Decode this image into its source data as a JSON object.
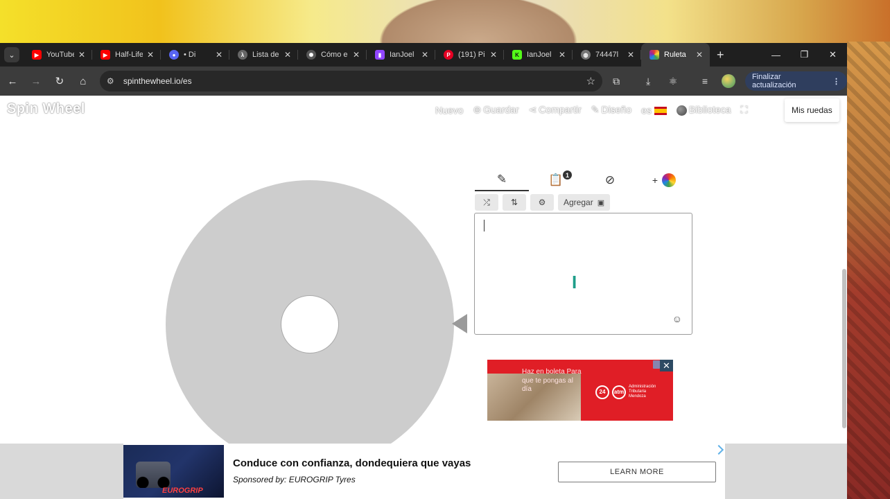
{
  "browser": {
    "tabs": [
      {
        "title": "YouTube",
        "favicon": "youtube-icon",
        "color": "#ff0000"
      },
      {
        "title": "Half-Life",
        "favicon": "youtube-icon",
        "color": "#ff0000"
      },
      {
        "title": "• Di",
        "favicon": "record-icon",
        "color": "#5865f2"
      },
      {
        "title": "Lista de",
        "favicon": "lambda-icon",
        "color": "#bbbbbb"
      },
      {
        "title": "Cómo e",
        "favicon": "openai-icon",
        "color": "#bbbbbb"
      },
      {
        "title": "IanJoel",
        "favicon": "twitch-icon",
        "color": "#9146ff"
      },
      {
        "title": "(191) Pi",
        "favicon": "pinterest-icon",
        "color": "#e60023"
      },
      {
        "title": "IanJoel",
        "favicon": "kick-icon",
        "color": "#53fc18"
      },
      {
        "title": "74447l",
        "favicon": "globe-icon",
        "color": "#bbbbbb"
      },
      {
        "title": "Ruleta",
        "favicon": "spinwheel-icon",
        "color": "#e55",
        "active": true
      }
    ],
    "url": "spinthewheel.io/es",
    "update_button": "Finalizar actualización"
  },
  "site": {
    "logo": "Spin Wheel",
    "nav": {
      "new": "Nuevo",
      "save": "Guardar",
      "share": "Compartir",
      "design": "Diseño",
      "lang": "es",
      "library": "Biblioteca",
      "my_wheels": "Mis ruedas"
    },
    "editor": {
      "results_badge": "1",
      "add_button": "Agregar",
      "entries_text": ""
    },
    "ad_banner": {
      "headline": "Haz en boleta Para que te pongas al día",
      "brand_code": "24",
      "brand_name": "atm",
      "agency": "Administración Tributaria Mendoza"
    },
    "bottom_ad": {
      "headline": "Conduce con confianza, dondequiera que vayas",
      "sponsor": "Sponsored by: EUROGRIP Tyres",
      "cta": "LEARN MORE",
      "brand_tag": "EUROGRIP"
    }
  },
  "colors": {
    "wheel": "#cdcdcd",
    "ad_red": "#e01e26",
    "tabstrip": "#1f1f1f",
    "toolbar": "#3c3c3c"
  }
}
